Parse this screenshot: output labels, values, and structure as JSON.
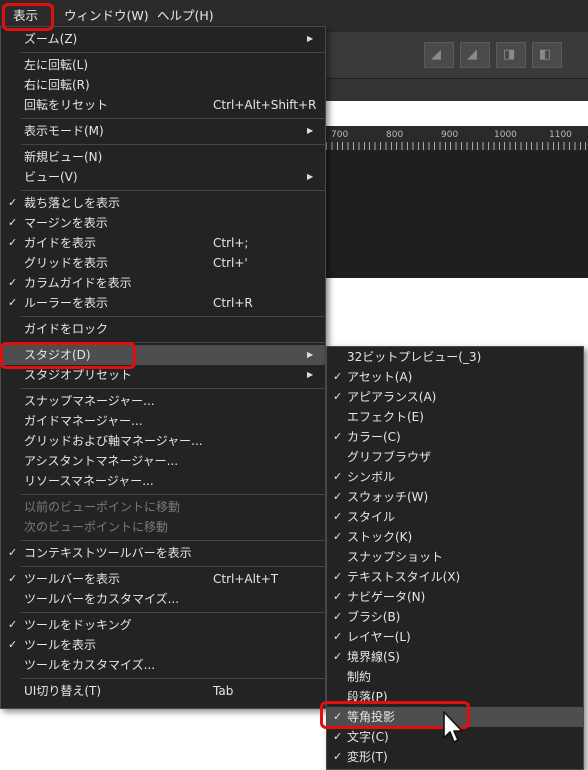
{
  "menubar": {
    "view": "表示",
    "window": "ウィンドウ(W)",
    "help": "ヘルプ(H)"
  },
  "ruler": {
    "ticks": [
      "700",
      "800",
      "900",
      "1000",
      "1100"
    ]
  },
  "view_menu": [
    {
      "label": "ズーム(Z)",
      "submenu": true
    },
    {
      "sep": true
    },
    {
      "label": "左に回転(L)"
    },
    {
      "label": "右に回転(R)"
    },
    {
      "label": "回転をリセット",
      "shortcut": "Ctrl+Alt+Shift+R"
    },
    {
      "sep": true
    },
    {
      "label": "表示モード(M)",
      "submenu": true
    },
    {
      "sep": true
    },
    {
      "label": "新規ビュー(N)"
    },
    {
      "label": "ビュー(V)",
      "submenu": true
    },
    {
      "sep": true
    },
    {
      "label": "裁ち落としを表示",
      "checked": true
    },
    {
      "label": "マージンを表示",
      "checked": true
    },
    {
      "label": "ガイドを表示",
      "checked": true,
      "shortcut": "Ctrl+;"
    },
    {
      "label": "グリッドを表示",
      "shortcut": "Ctrl+'"
    },
    {
      "label": "カラムガイドを表示",
      "checked": true
    },
    {
      "label": "ルーラーを表示",
      "checked": true,
      "shortcut": "Ctrl+R"
    },
    {
      "sep": true
    },
    {
      "label": "ガイドをロック"
    },
    {
      "sep": true
    },
    {
      "label": "スタジオ(D)",
      "submenu": true,
      "highlighted": true
    },
    {
      "label": "スタジオプリセット",
      "submenu": true
    },
    {
      "sep": true
    },
    {
      "label": "スナップマネージャー..."
    },
    {
      "label": "ガイドマネージャー..."
    },
    {
      "label": "グリッドおよび軸マネージャー..."
    },
    {
      "label": "アシスタントマネージャー..."
    },
    {
      "label": "リソースマネージャー..."
    },
    {
      "sep": true
    },
    {
      "label": "以前のビューポイントに移動",
      "disabled": true
    },
    {
      "label": "次のビューポイントに移動",
      "disabled": true
    },
    {
      "sep": true
    },
    {
      "label": "コンテキストツールバーを表示",
      "checked": true
    },
    {
      "sep": true
    },
    {
      "label": "ツールバーを表示",
      "checked": true,
      "shortcut": "Ctrl+Alt+T"
    },
    {
      "label": "ツールバーをカスタマイズ..."
    },
    {
      "sep": true
    },
    {
      "label": "ツールをドッキング",
      "checked": true
    },
    {
      "label": "ツールを表示",
      "checked": true
    },
    {
      "label": "ツールをカスタマイズ..."
    },
    {
      "sep": true
    },
    {
      "label": "UI切り替え(T)",
      "shortcut": "Tab"
    }
  ],
  "studio_submenu": [
    {
      "label": "32ビットプレビュー(_3)"
    },
    {
      "label": "アセット(A)",
      "checked": true
    },
    {
      "label": "アピアランス(A)",
      "checked": true
    },
    {
      "label": "エフェクト(E)"
    },
    {
      "label": "カラー(C)",
      "checked": true
    },
    {
      "label": "グリフブラウザ"
    },
    {
      "label": "シンボル",
      "checked": true
    },
    {
      "label": "スウォッチ(W)",
      "checked": true
    },
    {
      "label": "スタイル",
      "checked": true
    },
    {
      "label": "ストック(K)",
      "checked": true
    },
    {
      "label": "スナップショット"
    },
    {
      "label": "テキストスタイル(X)",
      "checked": true
    },
    {
      "label": "ナビゲータ(N)",
      "checked": true
    },
    {
      "label": "ブラシ(B)",
      "checked": true
    },
    {
      "label": "レイヤー(L)",
      "checked": true
    },
    {
      "label": "境界線(S)",
      "checked": true
    },
    {
      "label": "制約"
    },
    {
      "label": "段落(P)"
    },
    {
      "label": "等角投影",
      "checked": true,
      "highlighted": true
    },
    {
      "label": "文字(C)",
      "checked": true
    },
    {
      "label": "変形(T)",
      "checked": true
    }
  ],
  "glyphs": {
    "check": "✓",
    "arrow": "▶"
  },
  "colors": {
    "menu_bg": "#232323",
    "highlight": "#4e4e4e",
    "annotation": "#e01010"
  }
}
